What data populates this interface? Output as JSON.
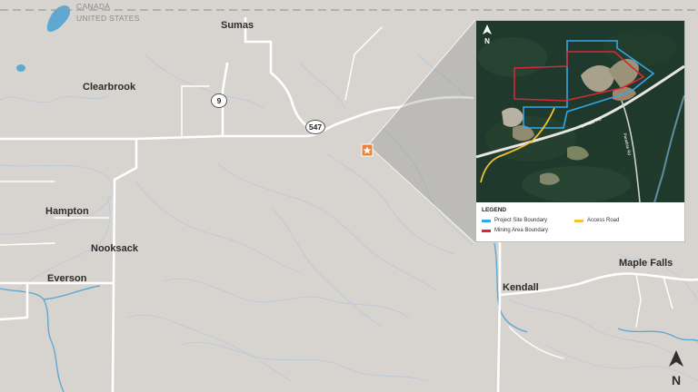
{
  "map": {
    "country_north": "CANADA",
    "country_south": "UNITED STATES",
    "places": {
      "sumas": "Sumas",
      "clearbrook": "Clearbrook",
      "hampton": "Hampton",
      "nooksack": "Nooksack",
      "everson": "Everson",
      "kendall": "Kendall",
      "maple_falls": "Maple Falls"
    },
    "routes": {
      "r9": "9",
      "r547": "547"
    },
    "north_arrow": "N",
    "colors": {
      "land": "#d7d4cf",
      "road": "#ffffff",
      "water": "#5fa8d3",
      "site_marker": "#e8843a"
    },
    "site_marker_icon": "star-icon"
  },
  "inset": {
    "north_arrow": "N",
    "road_label_1": "S Pass Rd",
    "road_label_2": "Paradise Rd",
    "legend": {
      "title": "LEGEND",
      "items": {
        "project": {
          "label": "Project Site Boundary",
          "color": "#35a7e6"
        },
        "mining": {
          "label": "Mining Area Boundary",
          "color": "#d8263a"
        },
        "access": {
          "label": "Access Road",
          "color": "#f2c230"
        }
      }
    }
  }
}
